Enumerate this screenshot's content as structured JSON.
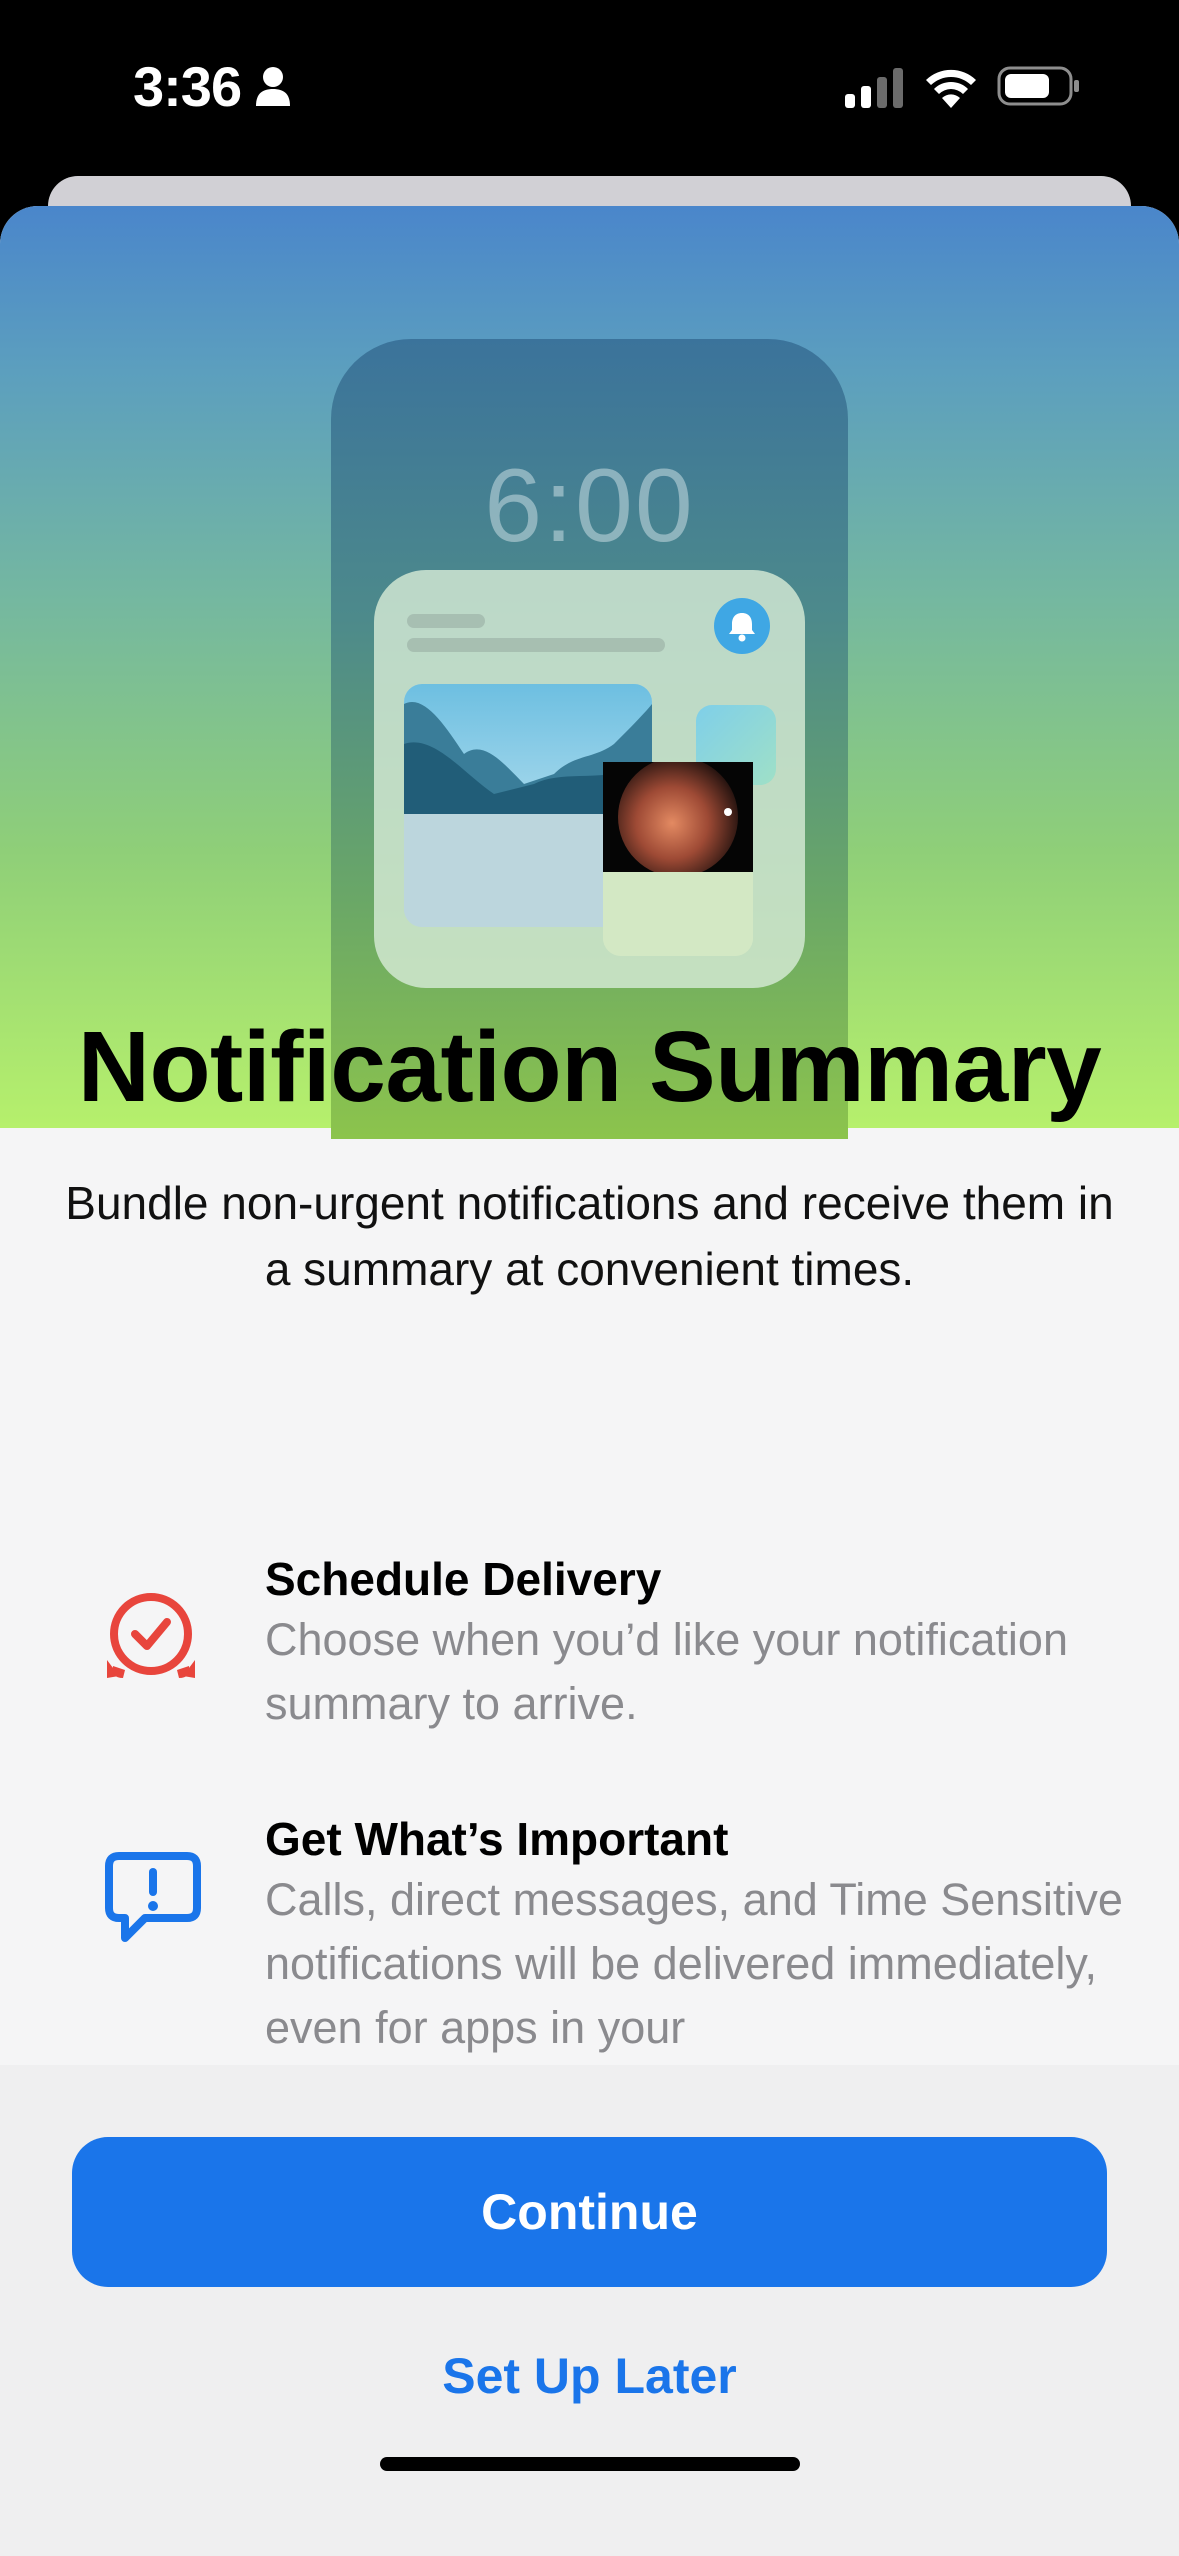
{
  "status_bar": {
    "time": "3:36",
    "icons": [
      "person-icon",
      "cellular-signal-icon",
      "wifi-icon",
      "battery-icon"
    ]
  },
  "hero": {
    "lock_screen_time": "6:00"
  },
  "content": {
    "title": "Notification Summary",
    "subtitle": "Bundle non-urgent notifications and receive them in a summary at convenient times.",
    "features": [
      {
        "icon": "alarm-clock-icon",
        "title": "Schedule Delivery",
        "description": "Choose when you’d like your notification summary to arrive."
      },
      {
        "icon": "exclamation-speech-bubble-icon",
        "title": "Get What’s Important",
        "description": "Calls, direct messages, and Time Sensitive notifications will be delivered immediately, even for apps in your"
      }
    ]
  },
  "actions": {
    "continue_label": "Continue",
    "later_label": "Set Up Later"
  },
  "colors": {
    "accent": "#1A75EA",
    "clock_icon": "#E8453C",
    "bubble_icon": "#1A75EA"
  }
}
